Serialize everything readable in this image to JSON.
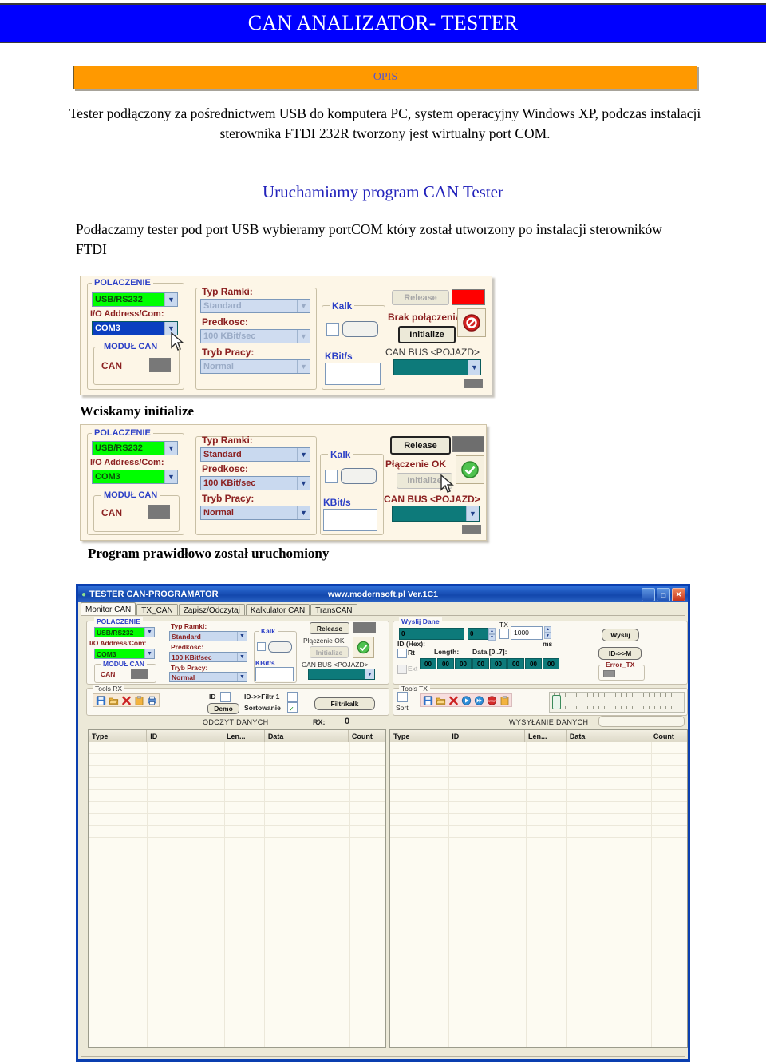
{
  "banner": {
    "title": "CAN ANALIZATOR- TESTER"
  },
  "opis": {
    "label": "OPIS"
  },
  "intro": {
    "paragraph": "Tester podłączony za pośrednictwem USB do komputera PC, system operacyjny Windows XP, podczas instalacji sterownika FTDI 232R tworzony jest wirtualny port COM."
  },
  "section": {
    "heading": "Uruchamiamy program  CAN Tester",
    "paragraph": "Podłaczamy tester pod port USB wybieramy portCOM  który został utworzony po instalacji sterowników FTDI"
  },
  "captions": {
    "press_initialize": "Wciskamy initialize",
    "program_started": "Program prawidłowo został uruchomiony"
  },
  "dialog1": {
    "group_connection": "POLACZENIE",
    "interface_value": "USB/RS232",
    "io_label": "I/O Address/Com:",
    "port_value": "COM3",
    "group_module": "MODUŁ CAN",
    "can_label": "CAN",
    "frame_type_label": "Typ Ramki:",
    "frame_type_value": "Standard",
    "speed_label": "Predkosc:",
    "speed_value": "100 KBit/sec",
    "mode_label": "Tryb Pracy:",
    "mode_value": "Normal",
    "kalk_label": "Kalk",
    "kbits_label": "KBit/s",
    "release_label": "Release",
    "status_text": "Brak połączenia",
    "initialize_label": "Initialize",
    "canbus_label": "CAN BUS <POJAZD>",
    "canbus_value": "",
    "status_icon": "forbidden-icon",
    "led_color": "#ff0000"
  },
  "dialog2": {
    "group_connection": "POLACZENIE",
    "interface_value": "USB/RS232",
    "io_label": "I/O Address/Com:",
    "port_value": "COM3",
    "group_module": "MODUŁ CAN",
    "can_label": "CAN",
    "frame_type_label": "Typ Ramki:",
    "frame_type_value": "Standard",
    "speed_label": "Predkosc:",
    "speed_value": "100 KBit/sec",
    "mode_label": "Tryb Pracy:",
    "mode_value": "Normal",
    "kalk_label": "Kalk",
    "kbits_label": "KBit/s",
    "release_label": "Release",
    "status_text": "Płączenie OK",
    "initialize_label": "Initialize",
    "canbus_label": "CAN BUS <POJAZD>",
    "canbus_value": "",
    "status_icon": "check-circle-icon",
    "led_color": "#6e6e6e"
  },
  "app": {
    "title": "TESTER CAN-PROGRAMATOR",
    "title_center": "www.modernsoft.pl  Ver.1C1",
    "window_buttons": {
      "minimize": "_",
      "maximize": "□",
      "close": "✕"
    },
    "tabs": [
      {
        "label": "Monitor CAN",
        "active": true
      },
      {
        "label": "TX_CAN",
        "active": false
      },
      {
        "label": "Zapisz/Odczytaj",
        "active": false
      },
      {
        "label": "Kalkulator CAN",
        "active": false
      },
      {
        "label": "TransCAN",
        "active": false
      }
    ],
    "connection": {
      "group_connection": "POLACZENIE",
      "interface_value": "USB/RS232",
      "io_label": "I/O Address/Com:",
      "port_value": "COM3",
      "group_module": "MODUŁ CAN",
      "can_label": "CAN",
      "frame_type_label": "Typ Ramki:",
      "frame_type_value": "Standard",
      "speed_label": "Predkosc:",
      "speed_value": "100 KBit/sec",
      "mode_label": "Tryb Pracy:",
      "mode_value": "Normal",
      "kalk_label": "Kalk",
      "kbits_label": "KBit/s",
      "release_label": "Release",
      "status_text": "Płączenie OK",
      "initialize_label": "Initialize",
      "canbus_label": "CAN BUS <POJAZD>"
    },
    "send_panel": {
      "group_label": "Wyslij Dane",
      "id_value": "0",
      "length_value": "0",
      "tx_label": "TX",
      "interval_value": "1000",
      "ms_label": "ms",
      "id_hex_label": "ID (Hex):",
      "rtr_label": "Rt",
      "ext_label": "Ext",
      "length_label": "Length:",
      "data_label": "Data [0..7]:",
      "data_bytes": [
        "00",
        "00",
        "00",
        "00",
        "00",
        "00",
        "00",
        "00"
      ],
      "send_button": "Wyslij",
      "id_to_m_button": "ID->>M",
      "error_tx_label": "Error_TX"
    },
    "tools_rx": {
      "group_label": "Tools RX",
      "icons": [
        "save-icon",
        "open-folder-icon",
        "delete-icon",
        "clipboard-icon",
        "print-icon"
      ],
      "demo_button": "Demo",
      "id_label": "ID",
      "id_filter_label": "ID->>Filtr 1",
      "sort_label": "Sortowanie",
      "sort_checked": true,
      "filter_button": "Filtr/kalk",
      "status_text": "ODCZYT DANYCH",
      "rx_label": "RX:",
      "rx_value": "0"
    },
    "tools_tx": {
      "group_label": "Tools TX",
      "sort_label": "Sort",
      "icons": [
        "save-icon",
        "open-folder-icon",
        "delete-icon",
        "play-icon",
        "fast-forward-icon",
        "stop-icon",
        "clipboard-icon"
      ],
      "status_text": "WYSYŁANIE DANYCH"
    },
    "table_rx": {
      "columns": [
        "Type",
        "ID",
        "Len...",
        "Data",
        "Count"
      ],
      "rows": []
    },
    "table_tx": {
      "columns": [
        "Type",
        "ID",
        "Len...",
        "Data",
        "Count"
      ],
      "rows": []
    }
  },
  "colors": {
    "banner_bg": "#0000ff",
    "opis_bg": "#ff9900",
    "heading_blue": "#2222bb",
    "green_field": "#00ff00",
    "teal_field": "#0d7a7a",
    "window_border": "#0a3fb0"
  }
}
